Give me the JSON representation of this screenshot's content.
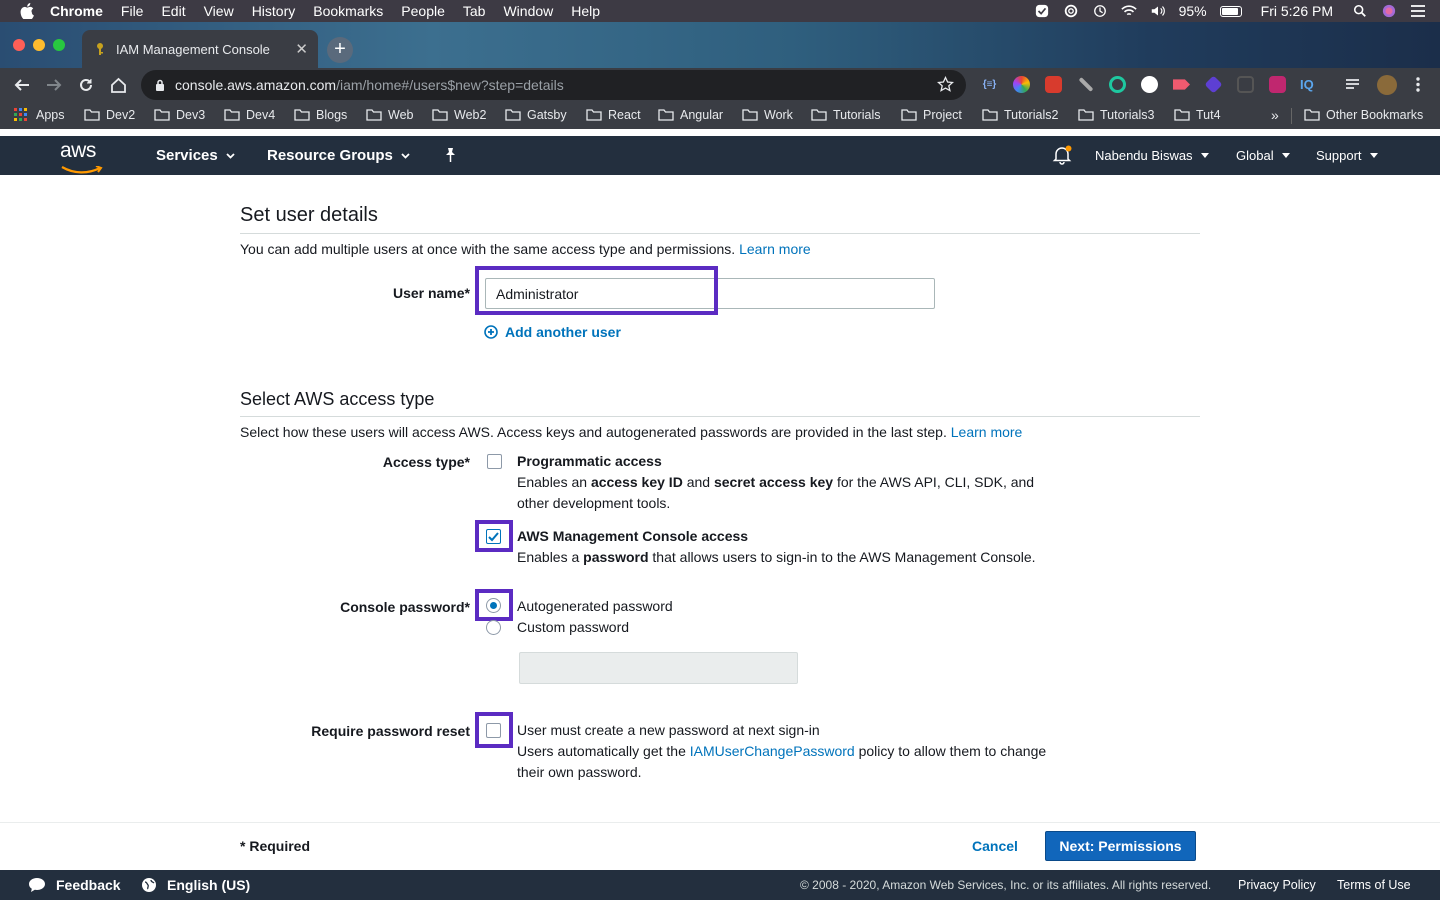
{
  "macos": {
    "menu": [
      "Chrome",
      "File",
      "Edit",
      "View",
      "History",
      "Bookmarks",
      "People",
      "Tab",
      "Window",
      "Help"
    ],
    "battery": "95%",
    "clock": "Fri 5:26 PM"
  },
  "browser": {
    "tab_title": "IAM Management Console",
    "url_host": "console.aws.amazon.com",
    "url_path": "/iam/home#/users$new?step=details",
    "bookmarks": [
      "Apps",
      "Dev2",
      "Dev3",
      "Dev4",
      "Blogs",
      "Web",
      "Web2",
      "Gatsby",
      "React",
      "Angular",
      "Work",
      "Tutorials",
      "Project",
      "Tutorials2",
      "Tutorials3",
      "Tut4"
    ],
    "bookmarks_more": "»",
    "other_bookmarks": "Other Bookmarks"
  },
  "aws_nav": {
    "logo": "aws",
    "services": "Services",
    "resource_groups": "Resource Groups",
    "user": "Nabendu Biswas",
    "region": "Global",
    "support": "Support"
  },
  "details": {
    "title": "Set user details",
    "description": "You can add multiple users at once with the same access type and permissions.",
    "learn_more": "Learn more",
    "username_label": "User name*",
    "username_value": "Administrator",
    "add_another_user": "Add another user"
  },
  "access": {
    "title": "Select AWS access type",
    "description": "Select how these users will access AWS. Access keys and autogenerated passwords are provided in the last step.",
    "learn_more": "Learn more",
    "access_type_label": "Access type*",
    "programmatic": {
      "title": "Programmatic access",
      "desc_1": "Enables an",
      "desc_bold_1": "access key ID",
      "desc_2": "and",
      "desc_bold_2": "secret access key",
      "desc_3": "for the AWS API, CLI, SDK, and",
      "desc_line2": "other development tools.",
      "checked": false
    },
    "console": {
      "title": "AWS Management Console access",
      "desc_1": "Enables a",
      "desc_bold": "password",
      "desc_2": "that allows users to sign-in to the AWS Management Console.",
      "checked": true
    },
    "password_label": "Console password*",
    "autogenerated": "Autogenerated password",
    "custom": "Custom password",
    "reset_label": "Require password reset",
    "reset_text": "User must create a new password at next sign-in",
    "reset_desc_1": "Users automatically get the",
    "reset_desc_link": "IAMUserChangePassword",
    "reset_desc_2": "policy to allow them to change",
    "reset_desc_line2": "their own password."
  },
  "actions": {
    "required": "* Required",
    "cancel": "Cancel",
    "next": "Next: Permissions"
  },
  "footer": {
    "feedback": "Feedback",
    "language": "English (US)",
    "copyright": "© 2008 - 2020, Amazon Web Services, Inc. or its affiliates. All rights reserved.",
    "privacy": "Privacy Policy",
    "terms": "Terms of Use"
  },
  "colors": {
    "aws_nav": "#232f3e",
    "link": "#0073bb",
    "primary_button": "#1166bb",
    "highlight": "#5b2bc2"
  }
}
